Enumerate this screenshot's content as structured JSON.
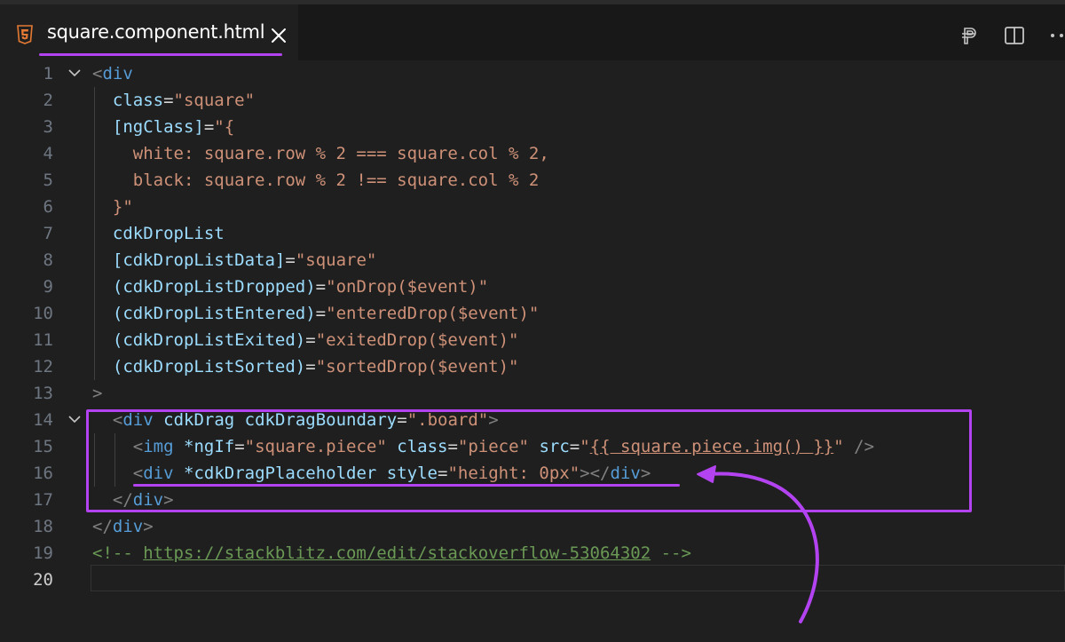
{
  "tab": {
    "filename": "square.component.html",
    "icon": "html5-icon"
  },
  "toolbar": {
    "icons": [
      "open-preview-icon",
      "split-editor-icon",
      "more-actions-icon"
    ]
  },
  "colors": {
    "accent": "#b343f0",
    "background": "#1f1f1f"
  },
  "editor": {
    "active_line": 20,
    "lines": [
      {
        "n": "1",
        "segs": [
          {
            "t": "<",
            "c": "t-punc"
          },
          {
            "t": "div",
            "c": "t-tag"
          }
        ]
      },
      {
        "n": "2",
        "segs": [
          {
            "t": "  "
          },
          {
            "t": "class",
            "c": "t-attr"
          },
          {
            "t": "=",
            "c": "t-def"
          },
          {
            "t": "\"square\"",
            "c": "t-str"
          }
        ]
      },
      {
        "n": "3",
        "segs": [
          {
            "t": "  "
          },
          {
            "t": "[ngClass]",
            "c": "t-attr"
          },
          {
            "t": "=",
            "c": "t-def"
          },
          {
            "t": "\"{",
            "c": "t-str"
          }
        ]
      },
      {
        "n": "4",
        "segs": [
          {
            "t": "    white: square.row % 2 === square.col % 2,",
            "c": "t-str"
          }
        ]
      },
      {
        "n": "5",
        "segs": [
          {
            "t": "    black: square.row % 2 !== square.col % 2",
            "c": "t-str"
          }
        ]
      },
      {
        "n": "6",
        "segs": [
          {
            "t": "  "
          },
          {
            "t": "}\"",
            "c": "t-str"
          }
        ]
      },
      {
        "n": "7",
        "segs": [
          {
            "t": "  "
          },
          {
            "t": "cdkDropList",
            "c": "t-attr"
          }
        ]
      },
      {
        "n": "8",
        "segs": [
          {
            "t": "  "
          },
          {
            "t": "[cdkDropListData]",
            "c": "t-attr"
          },
          {
            "t": "=",
            "c": "t-def"
          },
          {
            "t": "\"square\"",
            "c": "t-str"
          }
        ]
      },
      {
        "n": "9",
        "segs": [
          {
            "t": "  "
          },
          {
            "t": "(cdkDropListDropped)",
            "c": "t-attr"
          },
          {
            "t": "=",
            "c": "t-def"
          },
          {
            "t": "\"onDrop($event)\"",
            "c": "t-str"
          }
        ]
      },
      {
        "n": "10",
        "segs": [
          {
            "t": "  "
          },
          {
            "t": "(cdkDropListEntered)",
            "c": "t-attr"
          },
          {
            "t": "=",
            "c": "t-def"
          },
          {
            "t": "\"enteredDrop($event)\"",
            "c": "t-str"
          }
        ]
      },
      {
        "n": "11",
        "segs": [
          {
            "t": "  "
          },
          {
            "t": "(cdkDropListExited)",
            "c": "t-attr"
          },
          {
            "t": "=",
            "c": "t-def"
          },
          {
            "t": "\"exitedDrop($event)\"",
            "c": "t-str"
          }
        ]
      },
      {
        "n": "12",
        "segs": [
          {
            "t": "  "
          },
          {
            "t": "(cdkDropListSorted)",
            "c": "t-attr"
          },
          {
            "t": "=",
            "c": "t-def"
          },
          {
            "t": "\"sortedDrop($event)\"",
            "c": "t-str"
          }
        ]
      },
      {
        "n": "13",
        "segs": [
          {
            "t": ">",
            "c": "t-punc"
          }
        ]
      },
      {
        "n": "14",
        "segs": [
          {
            "t": "  "
          },
          {
            "t": "<",
            "c": "t-punc"
          },
          {
            "t": "div",
            "c": "t-tag"
          },
          {
            "t": " "
          },
          {
            "t": "cdkDrag",
            "c": "t-attr"
          },
          {
            "t": " "
          },
          {
            "t": "cdkDragBoundary",
            "c": "t-attr"
          },
          {
            "t": "=",
            "c": "t-def"
          },
          {
            "t": "\".board\"",
            "c": "t-str"
          },
          {
            "t": ">",
            "c": "t-punc"
          }
        ]
      },
      {
        "n": "15",
        "segs": [
          {
            "t": "    "
          },
          {
            "t": "<",
            "c": "t-punc"
          },
          {
            "t": "img",
            "c": "t-tag"
          },
          {
            "t": " "
          },
          {
            "t": "*ngIf",
            "c": "t-attr"
          },
          {
            "t": "=",
            "c": "t-def"
          },
          {
            "t": "\"square.piece\"",
            "c": "t-str"
          },
          {
            "t": " "
          },
          {
            "t": "class",
            "c": "t-attr"
          },
          {
            "t": "=",
            "c": "t-def"
          },
          {
            "t": "\"piece\"",
            "c": "t-str"
          },
          {
            "t": " "
          },
          {
            "t": "src",
            "c": "t-attr"
          },
          {
            "t": "=",
            "c": "t-def"
          },
          {
            "t": "\"",
            "c": "t-str"
          },
          {
            "t": "{{ square.piece.img() }}",
            "c": "t-strU"
          },
          {
            "t": "\"",
            "c": "t-str"
          },
          {
            "t": " "
          },
          {
            "t": "/>",
            "c": "t-punc"
          }
        ]
      },
      {
        "n": "16",
        "segs": [
          {
            "t": "    "
          },
          {
            "t": "<",
            "c": "t-punc"
          },
          {
            "t": "div",
            "c": "t-tag"
          },
          {
            "t": " "
          },
          {
            "t": "*cdkDragPlaceholder",
            "c": "t-attr"
          },
          {
            "t": " "
          },
          {
            "t": "style",
            "c": "t-attr"
          },
          {
            "t": "=",
            "c": "t-def"
          },
          {
            "t": "\"height: 0px\"",
            "c": "t-str"
          },
          {
            "t": "></",
            "c": "t-punc"
          },
          {
            "t": "div",
            "c": "t-tag"
          },
          {
            "t": ">",
            "c": "t-punc"
          }
        ]
      },
      {
        "n": "17",
        "segs": [
          {
            "t": "  "
          },
          {
            "t": "</",
            "c": "t-punc"
          },
          {
            "t": "div",
            "c": "t-tag"
          },
          {
            "t": ">",
            "c": "t-punc"
          }
        ]
      },
      {
        "n": "18",
        "segs": [
          {
            "t": "</",
            "c": "t-punc"
          },
          {
            "t": "div",
            "c": "t-tag"
          },
          {
            "t": ">",
            "c": "t-punc"
          }
        ]
      },
      {
        "n": "19",
        "segs": [
          {
            "t": "<!-- ",
            "c": "t-com"
          },
          {
            "t": "https://stackblitz.com/edit/stackoverflow-53064302",
            "c": "t-link"
          },
          {
            "t": " -->",
            "c": "t-com"
          }
        ]
      },
      {
        "n": "20",
        "segs": []
      }
    ]
  }
}
